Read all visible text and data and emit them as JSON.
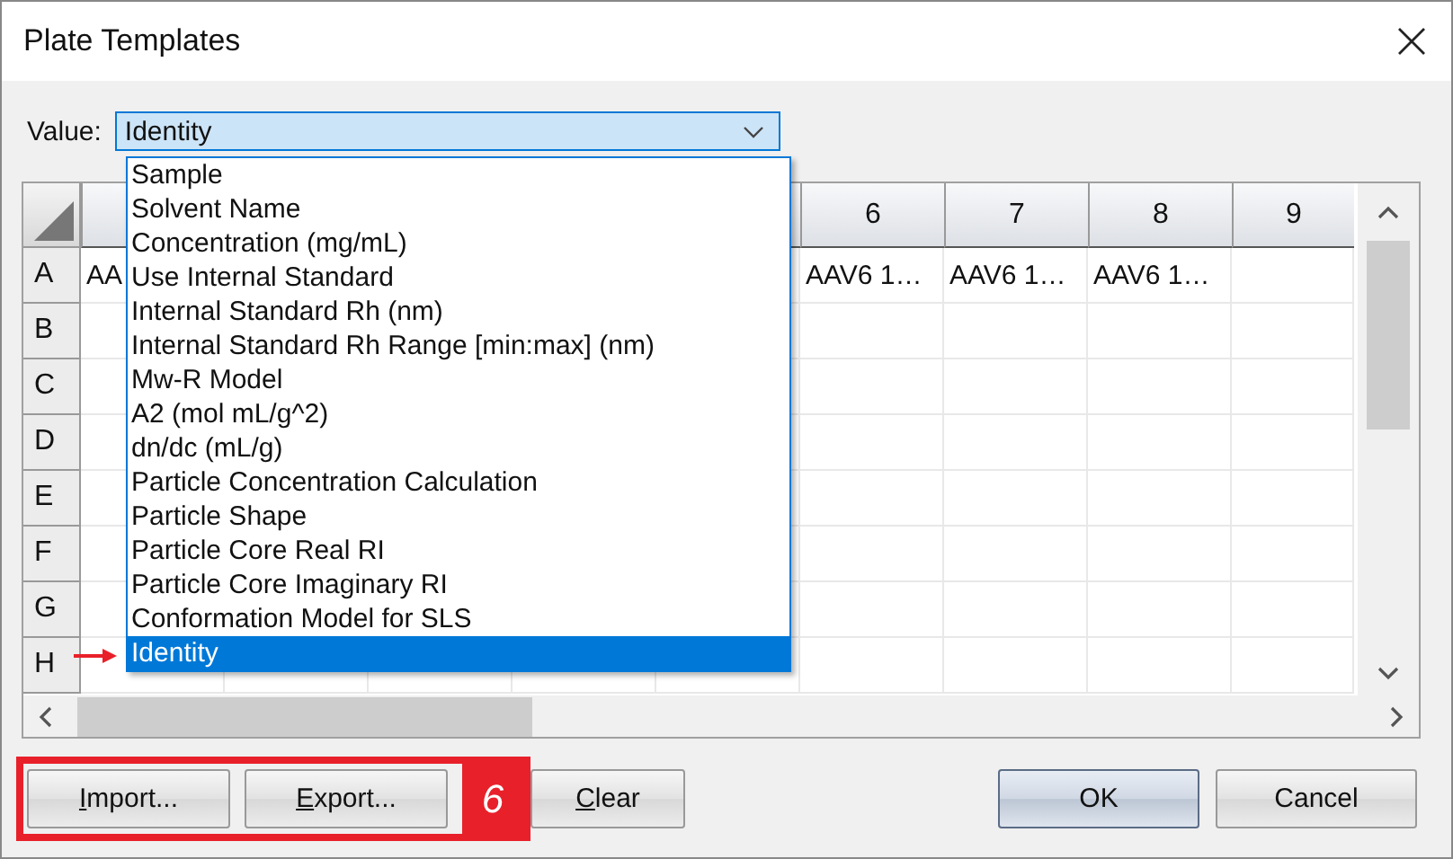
{
  "window": {
    "title": "Plate Templates"
  },
  "value_field": {
    "label": "Value:",
    "value": "Identity",
    "expanded": true
  },
  "dropdown_options": [
    {
      "label": "Sample",
      "selected": false
    },
    {
      "label": "Solvent Name",
      "selected": false
    },
    {
      "label": "Concentration (mg/mL)",
      "selected": false
    },
    {
      "label": "Use Internal Standard",
      "selected": false
    },
    {
      "label": "Internal Standard Rh (nm)",
      "selected": false
    },
    {
      "label": "Internal Standard Rh Range [min:max] (nm)",
      "selected": false
    },
    {
      "label": "Mw-R Model",
      "selected": false
    },
    {
      "label": "A2 (mol mL/g^2)",
      "selected": false
    },
    {
      "label": "dn/dc (mL/g)",
      "selected": false
    },
    {
      "label": "Particle Concentration Calculation",
      "selected": false
    },
    {
      "label": "Particle Shape",
      "selected": false
    },
    {
      "label": "Particle Core Real RI",
      "selected": false
    },
    {
      "label": "Particle Core Imaginary RI",
      "selected": false
    },
    {
      "label": "Conformation Model for SLS",
      "selected": false
    },
    {
      "label": "Identity",
      "selected": true
    }
  ],
  "table": {
    "columns": [
      null,
      null,
      null,
      null,
      null,
      "6",
      "7",
      "8",
      "9"
    ],
    "rows": [
      {
        "header": "A",
        "cells": [
          "AA",
          null,
          null,
          null,
          null,
          "AAV6 1…",
          "AAV6 1…",
          "AAV6 1…",
          null
        ]
      },
      {
        "header": "B"
      },
      {
        "header": "C"
      },
      {
        "header": "D"
      },
      {
        "header": "E"
      },
      {
        "header": "F"
      },
      {
        "header": "G"
      },
      {
        "header": "H"
      }
    ]
  },
  "buttons": [
    {
      "label": "Import...",
      "mnemonic": true,
      "default": false
    },
    {
      "label": "Export...",
      "mnemonic": true,
      "default": false
    },
    {
      "label": "Clear",
      "mnemonic": true,
      "default": false
    },
    {
      "label": "OK",
      "mnemonic": false,
      "default": true
    },
    {
      "label": "Cancel",
      "mnemonic": false,
      "default": false
    }
  ],
  "annotation": {
    "label": "6"
  }
}
